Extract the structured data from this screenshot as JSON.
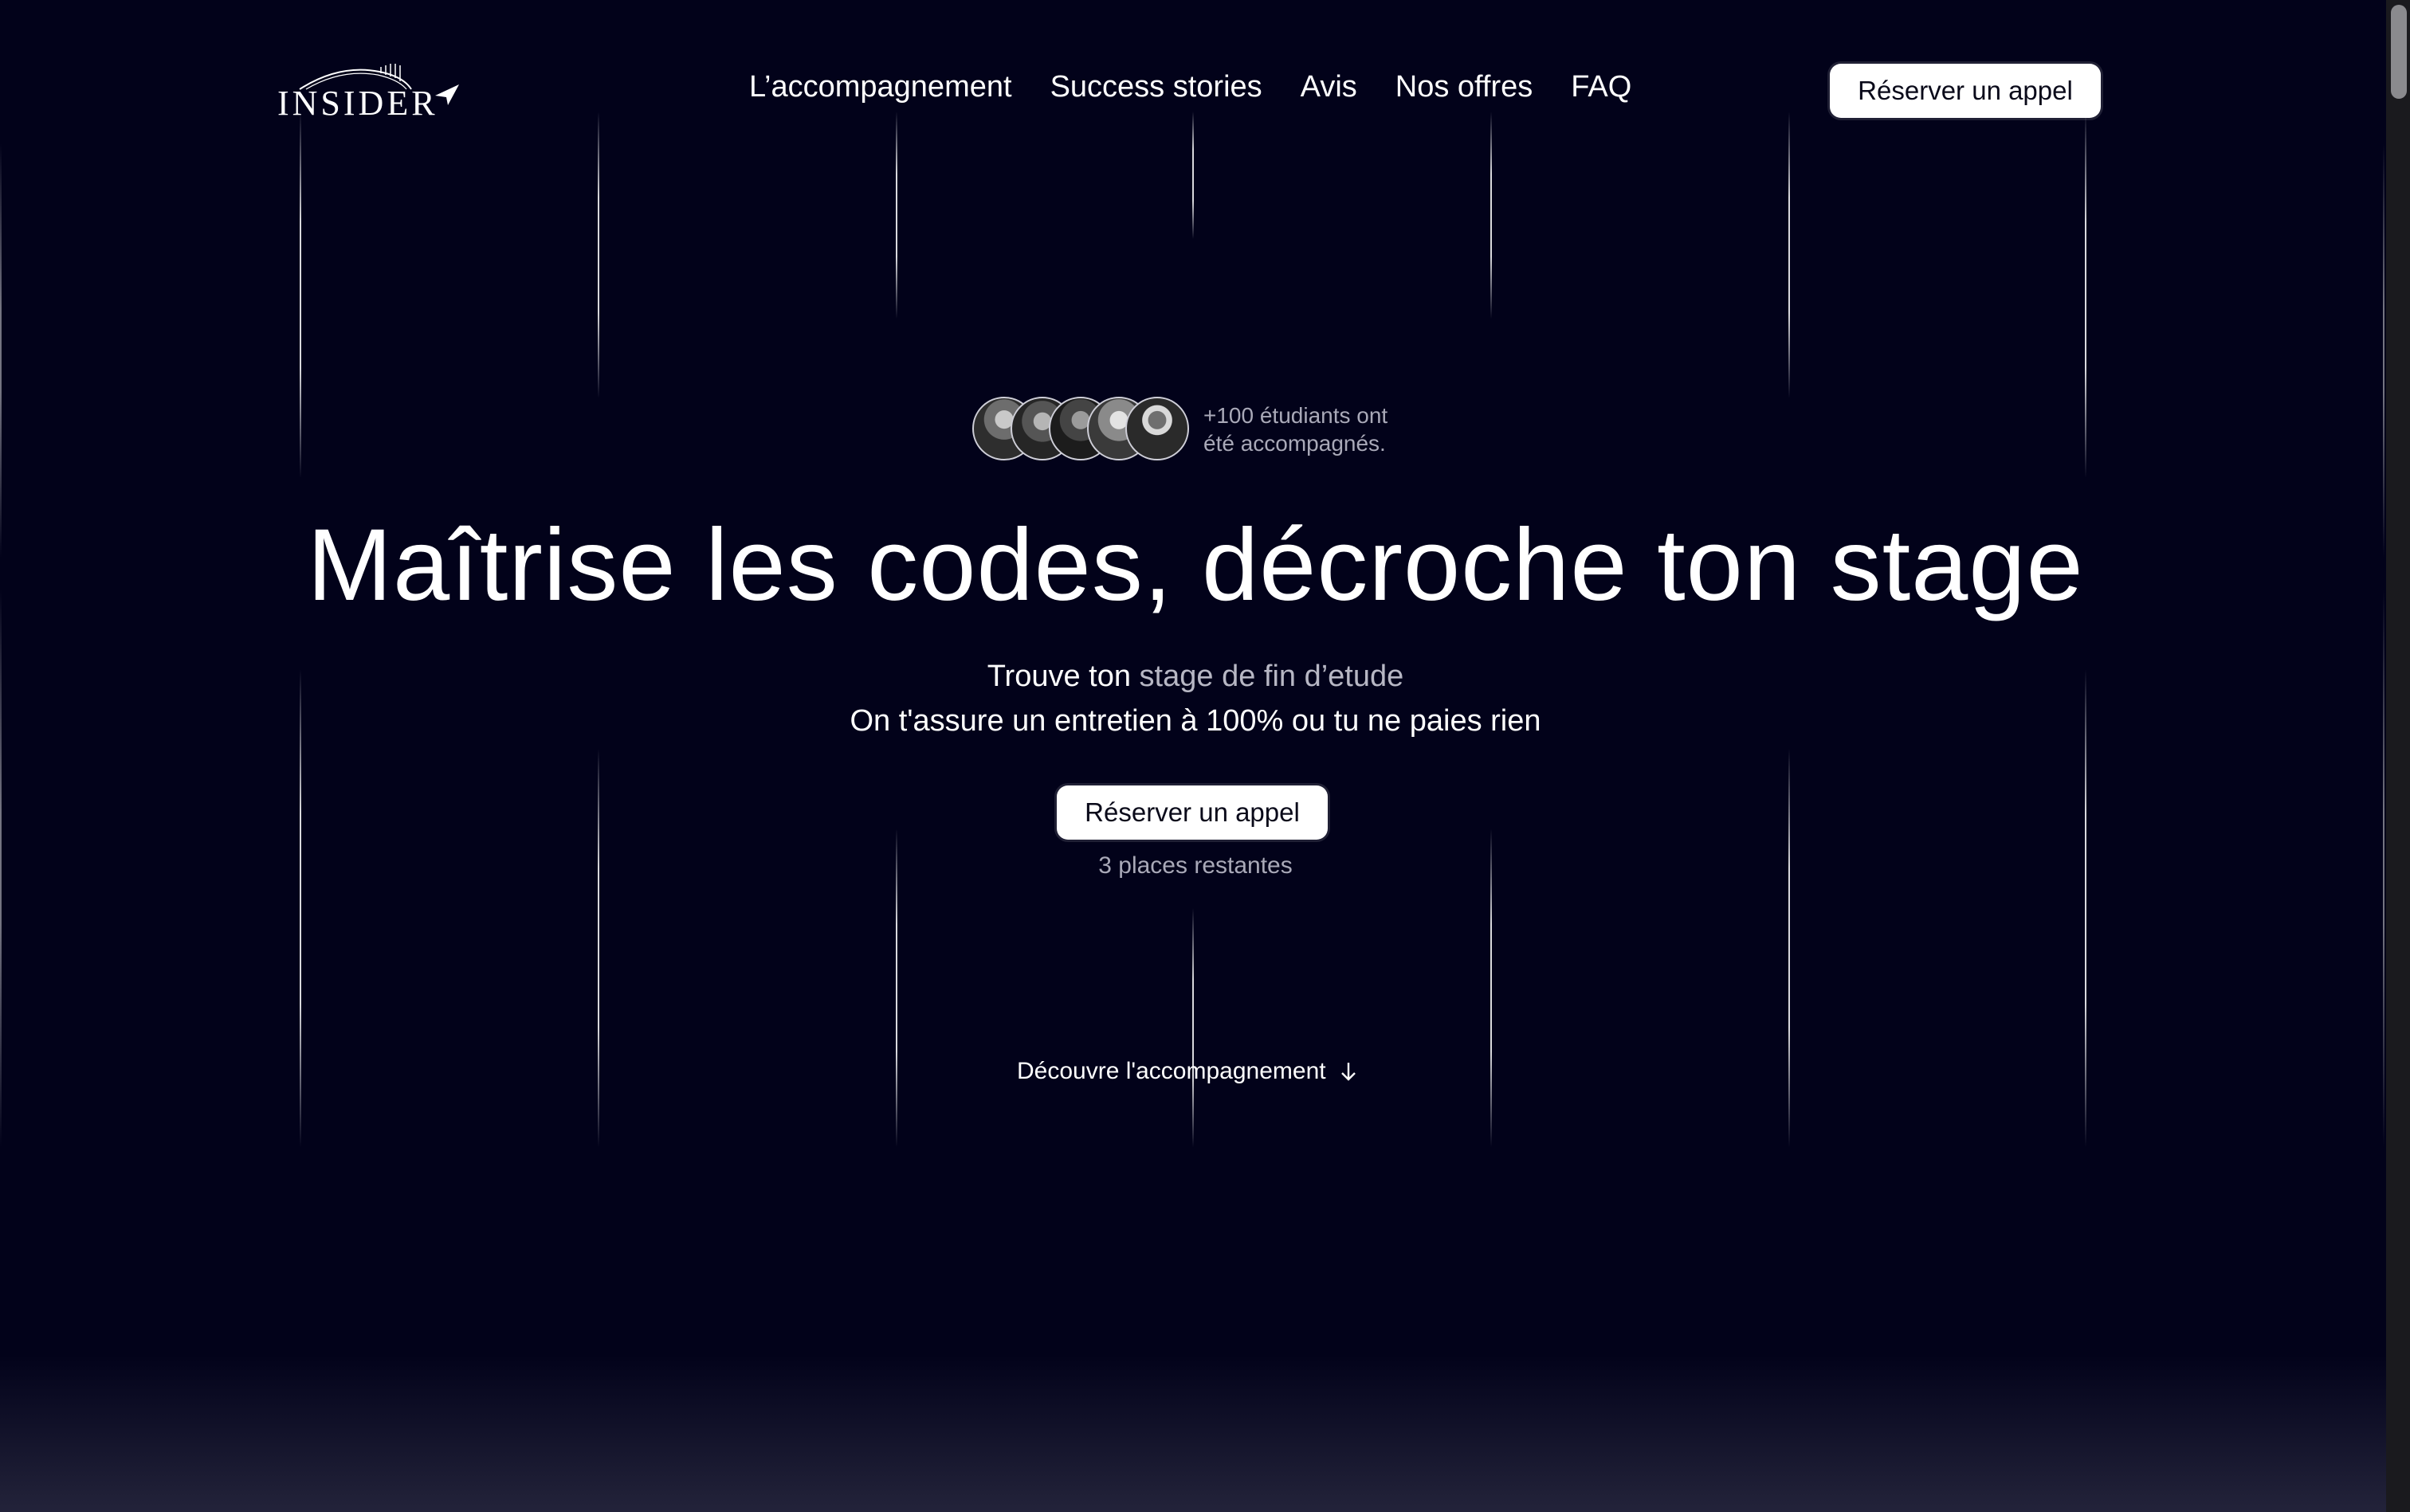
{
  "header": {
    "logo_text": "INSIDER",
    "logo_icon": "paper-plane-icon",
    "nav": [
      {
        "label": "L’accompagnement"
      },
      {
        "label": "Success stories"
      },
      {
        "label": "Avis"
      },
      {
        "label": "Nos offres"
      },
      {
        "label": "FAQ"
      }
    ],
    "cta_label": "Réserver un appel"
  },
  "social_proof": {
    "line1": "+100 étudiants ont",
    "line2": "été accompagnés.",
    "avatar_count": 5
  },
  "hero": {
    "title": "Maîtrise les codes, décroche ton stage",
    "subtitle_prefix": "Trouve ton",
    "subtitle_highlight": "stage de fin d’etude",
    "subtitle_line2": "On t'assure un entretien à 100% ou tu ne paies rien",
    "cta_label": "Réserver un appel",
    "places": "3 places restantes",
    "discover_label": "Découvre l'accompagnement",
    "discover_icon": "arrow-down-icon"
  },
  "colors": {
    "background": "#02021a",
    "button_bg": "#ffffff",
    "button_text": "#0a0a1a",
    "muted_text": "#a9a9b8"
  }
}
